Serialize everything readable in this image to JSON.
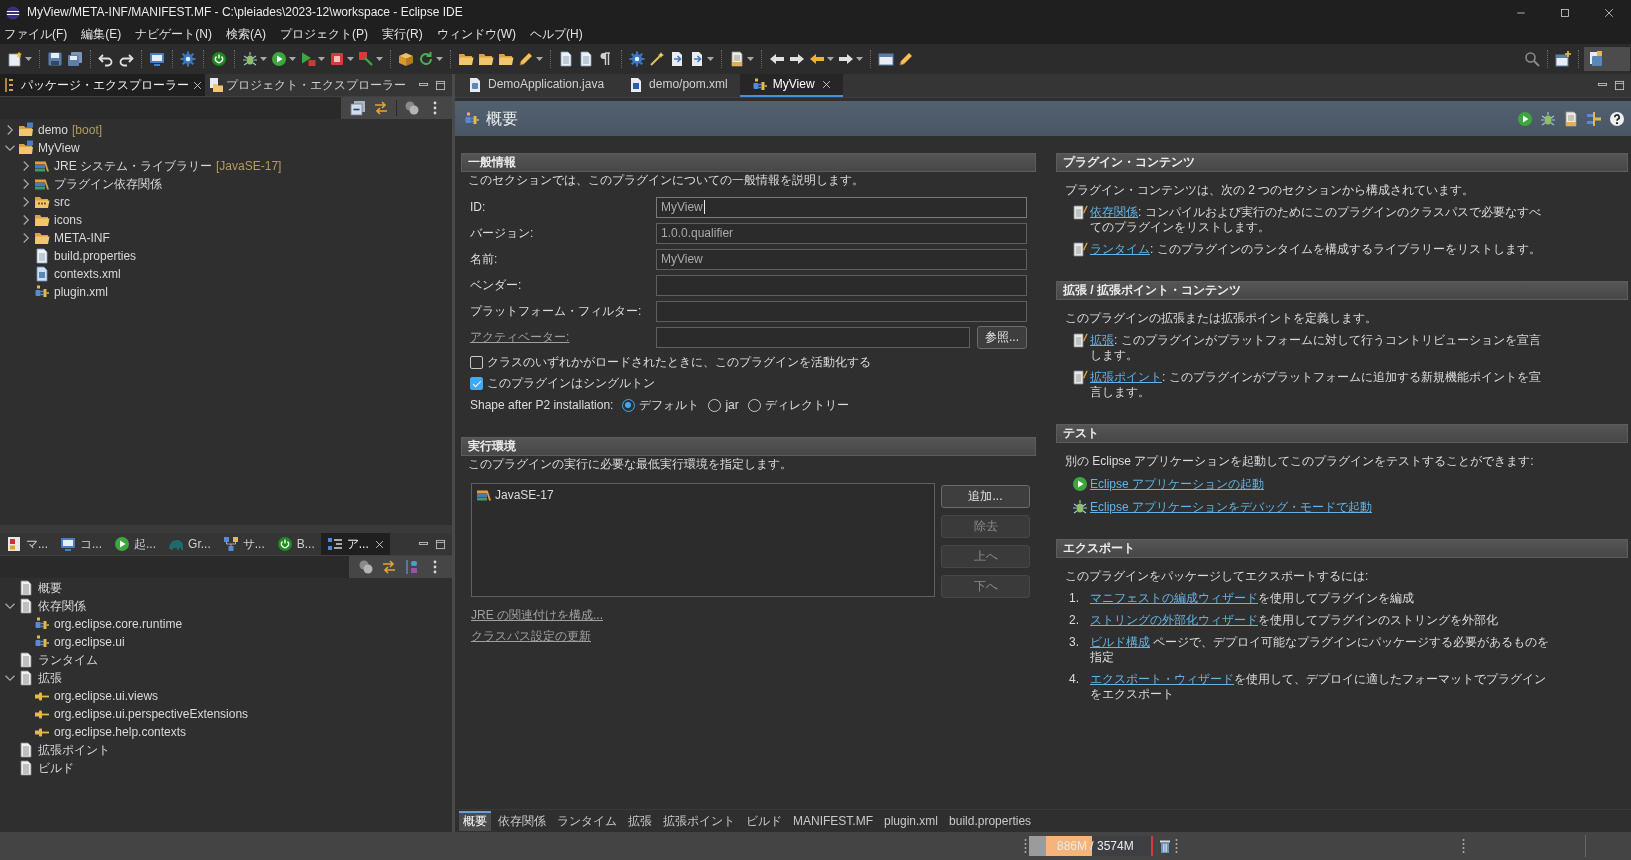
{
  "window": {
    "title": "MyView/META-INF/MANIFEST.MF - C:\\pleiades\\2023-12\\workspace - Eclipse IDE"
  },
  "menu_bar": [
    "ファイル(F)",
    "編集(E)",
    "ナビゲート(N)",
    "検索(A)",
    "プロジェクト(P)",
    "実行(R)",
    "ウィンドウ(W)",
    "ヘルプ(H)"
  ],
  "package_explorer": {
    "tabs": [
      {
        "label": "パッケージ・エクスプローラー",
        "kind": "package-explorer",
        "selected": true
      },
      {
        "label": "プロジェクト・エクスプローラー",
        "kind": "project-explorer",
        "selected": false
      }
    ],
    "tree": [
      {
        "label": "demo",
        "decoration": "[boot]",
        "kind": "project",
        "expanded": false
      },
      {
        "label": "MyView",
        "kind": "project",
        "expanded": true,
        "children": [
          {
            "label": "JRE システム・ライブラリー",
            "decoration": "[JavaSE-17]",
            "kind": "library",
            "expanded": false
          },
          {
            "label": "プラグイン依存関係",
            "kind": "library",
            "expanded": false
          },
          {
            "label": "src",
            "kind": "source-folder",
            "expanded": false
          },
          {
            "label": "icons",
            "kind": "folder",
            "expanded": false
          },
          {
            "label": "META-INF",
            "kind": "folder",
            "expanded": false
          },
          {
            "label": "build.properties",
            "kind": "properties-file"
          },
          {
            "label": "contexts.xml",
            "kind": "xml-file"
          },
          {
            "label": "plugin.xml",
            "kind": "plugin-manifest"
          }
        ]
      }
    ]
  },
  "outline": {
    "tabs": [
      {
        "label": "マ...",
        "kind": "markers",
        "selected": false
      },
      {
        "label": "コ...",
        "kind": "console",
        "selected": false
      },
      {
        "label": "起...",
        "kind": "launch",
        "selected": false
      },
      {
        "label": "Gr...",
        "kind": "gradle",
        "selected": false
      },
      {
        "label": "サ...",
        "kind": "servers",
        "selected": false
      },
      {
        "label": "B...",
        "kind": "boot-dashboard",
        "selected": false
      },
      {
        "label": "ア...",
        "kind": "outline",
        "selected": true
      }
    ],
    "tree": [
      {
        "label": "概要",
        "kind": "page"
      },
      {
        "label": "依存関係",
        "kind": "page",
        "expanded": true,
        "children": [
          {
            "label": "org.eclipse.core.runtime",
            "kind": "plugin"
          },
          {
            "label": "org.eclipse.ui",
            "kind": "plugin"
          }
        ]
      },
      {
        "label": "ランタイム",
        "kind": "page"
      },
      {
        "label": "拡張",
        "kind": "page",
        "expanded": true,
        "children": [
          {
            "label": "org.eclipse.ui.views",
            "kind": "extension"
          },
          {
            "label": "org.eclipse.ui.perspectiveExtensions",
            "kind": "extension"
          },
          {
            "label": "org.eclipse.help.contexts",
            "kind": "extension"
          }
        ]
      },
      {
        "label": "拡張ポイント",
        "kind": "page"
      },
      {
        "label": "ビルド",
        "kind": "page"
      }
    ]
  },
  "editor": {
    "tabs": [
      {
        "label": "DemoApplication.java",
        "kind": "java",
        "selected": false
      },
      {
        "label": "demo/pom.xml",
        "kind": "maven",
        "selected": false
      },
      {
        "label": "MyView",
        "kind": "plugin",
        "selected": true
      }
    ],
    "form": {
      "title": "概要",
      "general": {
        "title": "一般情報",
        "description": "このセクションでは、このプラグインについての一般情報を説明します。",
        "fields": [
          {
            "label": "ID:",
            "kind": "text",
            "value": "MyView",
            "focused": true
          },
          {
            "label": "バージョン:",
            "kind": "text",
            "value": "1.0.0.qualifier",
            "focused": false
          },
          {
            "label": "名前:",
            "kind": "text",
            "value": "MyView",
            "focused": false
          },
          {
            "label": "ベンダー:",
            "kind": "text",
            "focused": false
          },
          {
            "label": "プラットフォーム・フィルター:",
            "kind": "text",
            "focused": false
          },
          {
            "label": "アクティベーター:",
            "kind": "browse",
            "focused": false,
            "button": "参照..."
          }
        ],
        "checkboxes": [
          {
            "label": "クラスのいずれかがロードされたときに、このプラグインを活動化する",
            "checked": false
          },
          {
            "label": "このプラグインはシングルトン",
            "checked": true
          }
        ],
        "shape": {
          "label": "Shape after P2 installation:",
          "options": [
            {
              "label": "デフォルト",
              "selected": true
            },
            {
              "label": "jar",
              "selected": false
            },
            {
              "label": "ディレクトリー",
              "selected": false
            }
          ]
        }
      },
      "environment": {
        "title": "実行環境",
        "description": "このプラグインの実行に必要な最低実行環境を指定します。",
        "items": [
          "JavaSE-17"
        ],
        "buttons": [
          {
            "label": "追加...",
            "disabled": false
          },
          {
            "label": "除去",
            "disabled": true
          },
          {
            "label": "上へ",
            "disabled": true
          },
          {
            "label": "下へ",
            "disabled": true
          }
        ],
        "links": [
          "JRE の関連付けを構成...",
          "クラスパス設定の更新"
        ]
      },
      "plugin_content": {
        "title": "プラグイン・コンテンツ",
        "description": "プラグイン・コンテンツは、次の 2 つのセクションから構成されています。",
        "items": [
          {
            "link": "依存関係",
            "text": ": コンパイルおよび実行のためにこのプラグインのクラスパスで必要なすべてのプラグインをリストします。"
          },
          {
            "link": "ランタイム",
            "text": ": このプラグインのランタイムを構成するライブラリーをリストします。"
          }
        ]
      },
      "extensions": {
        "title": "拡張 / 拡張ポイント・コンテンツ",
        "description": "このプラグインの拡張または拡張ポイントを定義します。",
        "items": [
          {
            "link": "拡張",
            "text": ": このプラグインがプラットフォームに対して行うコントリビューションを宣言します。"
          },
          {
            "link": "拡張ポイント",
            "text": ": このプラグインがプラットフォームに追加する新規機能ポイントを宣言します。"
          }
        ]
      },
      "testing": {
        "title": "テスト",
        "description": "別の Eclipse アプリケーションを起動してこのプラグインをテストすることができます:",
        "links": [
          {
            "label": "Eclipse アプリケーションの起動",
            "kind": "run"
          },
          {
            "label": "Eclipse アプリケーションをデバッグ・モードで起動",
            "kind": "debug"
          }
        ]
      },
      "export": {
        "title": "エクスポート",
        "description": "このプラグインをパッケージしてエクスポートするには:",
        "steps": [
          {
            "number": "1.",
            "link": "マニフェストの編成ウィザード",
            "text": "を使用してプラグインを編成"
          },
          {
            "number": "2.",
            "link": "ストリングの外部化ウィザード",
            "text": "を使用してプラグインのストリングを外部化"
          },
          {
            "number": "3.",
            "link": "ビルド構成",
            "text": " ページで、デプロイ可能なプラグインにパッケージする必要があるものを指定"
          },
          {
            "number": "4.",
            "link": "エクスポート・ウィザード",
            "text": "を使用して、デプロイに適したフォーマットでプラグインをエクスポート"
          }
        ]
      }
    },
    "page_tabs": [
      {
        "label": "概要",
        "selected": true
      },
      {
        "label": "依存関係",
        "selected": false
      },
      {
        "label": "ランタイム",
        "selected": false
      },
      {
        "label": "拡張",
        "selected": false
      },
      {
        "label": "拡張ポイント",
        "selected": false
      },
      {
        "label": "ビルド",
        "selected": false
      },
      {
        "label": "MANIFEST.MF",
        "selected": false
      },
      {
        "label": "plugin.xml",
        "selected": false
      },
      {
        "label": "build.properties",
        "selected": false
      }
    ]
  },
  "status_bar": {
    "heap": {
      "text": "886M / 3574M",
      "level": 0.52
    }
  }
}
